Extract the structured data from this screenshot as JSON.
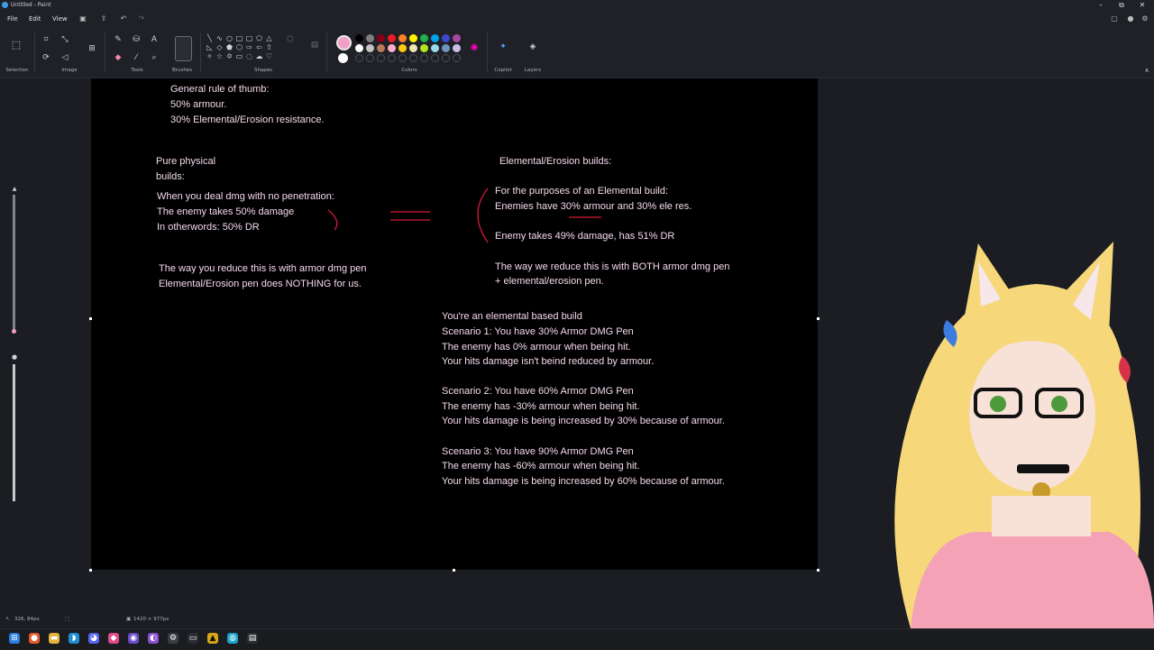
{
  "window": {
    "title": "Untitled - Paint",
    "min_icon": "minimize-icon",
    "max_icon": "restore-icon",
    "close_icon": "close-icon"
  },
  "menu": {
    "file": "File",
    "edit": "Edit",
    "view": "View"
  },
  "ribbon": {
    "groups": {
      "selection": "Selection",
      "image": "Image",
      "tools": "Tools",
      "brushes": "Brushes",
      "shapes": "Shapes",
      "colors": "Colors",
      "copilot": "Copilot",
      "layers": "Layers"
    },
    "primary_color": "#f29fc5",
    "secondary_color": "#ffffff",
    "palette_row1": [
      "#000000",
      "#7f7f7f",
      "#880015",
      "#ed1c24",
      "#ff7f27",
      "#fff200",
      "#22b14c",
      "#00a2e8",
      "#3f48cc",
      "#a349a4"
    ],
    "palette_row2": [
      "#ffffff",
      "#c3c3c3",
      "#b97a57",
      "#ffaec9",
      "#ffc90e",
      "#efe4b0",
      "#b5e61d",
      "#99d9ea",
      "#7092be",
      "#c8bfe7"
    ]
  },
  "canvas": {
    "rule_title": "General rule of thumb:",
    "rule_line1": "50% armour.",
    "rule_line2": "30% Elemental/Erosion resistance.",
    "phys_title_1": "Pure physical",
    "phys_title_2": "builds:",
    "phys_line1": "When you deal dmg with no penetration:",
    "phys_line2": "The enemy takes 50% damage",
    "phys_line3": "In otherwords: 50% DR",
    "phys_reduce1": "The way you reduce this is with armor dmg pen",
    "phys_reduce2": "Elemental/Erosion pen does NOTHING for us.",
    "elem_title": "Elemental/Erosion builds:",
    "elem_line1": "For the purposes of an Elemental build:",
    "elem_line2": "Enemies have 30% armour and 30% ele res.",
    "elem_line3": "Enemy takes 49% damage, has 51% DR",
    "elem_reduce1": "The way we reduce this is with BOTH armor dmg pen",
    "elem_reduce2": "+ elemental/erosion pen.",
    "scen_intro": "You're an elemental based build",
    "s1_a": "Scenario 1: You have 30% Armor DMG Pen",
    "s1_b": "The enemy has 0% armour when being hit.",
    "s1_c": "Your hits damage isn't beind reduced by armour.",
    "s2_a": "Scenario 2: You have 60% Armor DMG Pen",
    "s2_b": "The enemy has -30% armour when being hit.",
    "s2_c": "Your hits damage is being increased by 30% because of armour.",
    "s3_a": "Scenario 3: You have 90% Armor DMG Pen",
    "s3_b": "The enemy has -60% armour when being hit.",
    "s3_c": "Your hits damage is being increased by 60% because of armour.",
    "ink_color": "#d9173a"
  },
  "status": {
    "cursor_pos": "326, 84px",
    "canvas_size": "1420 × 977px"
  },
  "taskbar": {
    "icons": [
      "windows-start-icon",
      "firefox-icon",
      "file-explorer-icon",
      "edge-icon",
      "discord-icon",
      "app-icon",
      "obs-icon",
      "chrome-icon",
      "terminal-icon",
      "warning-app-icon",
      "paint-icon",
      "settings-icon"
    ]
  }
}
